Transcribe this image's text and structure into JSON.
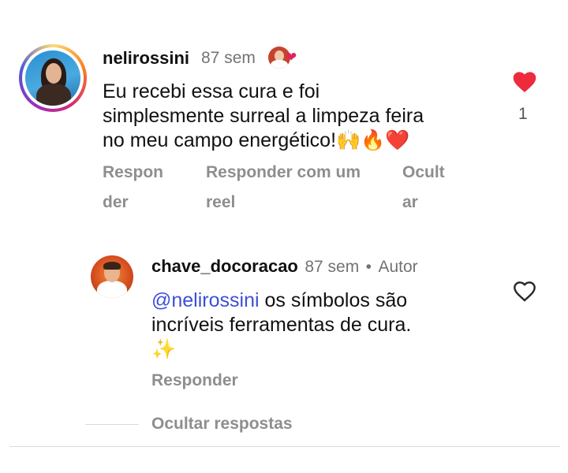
{
  "comment": {
    "username": "nelirossini",
    "time": "87 sem",
    "text_line1": "Eu recebi essa cura e foi",
    "text_line2": "simplesmente surreal a limpeza feira",
    "text_line3": "no meu campo energético!",
    "emojis": "🙌🔥❤️",
    "like_count": "1",
    "actions": {
      "reply_l1": "Respon",
      "reply_l2": "der",
      "reel_l1": "Responder com um",
      "reel_l2": "reel",
      "hide_l1": "Ocult",
      "hide_l2": "ar"
    },
    "heart_icon": "heart-filled-icon",
    "heart_color": "#ed2b3c"
  },
  "reply": {
    "username": "chave_docoracao",
    "time": "87 sem",
    "separator": "•",
    "author_tag": "Autor",
    "mention": "@nelirossini",
    "text_line1_rest": " os símbolos são",
    "text_line2": "incríveis ferramentas de cura.",
    "emoji": "✨",
    "reply_label": "Responder",
    "heart_icon": "heart-outline-icon"
  },
  "hide_replies_label": "Ocultar respostas"
}
